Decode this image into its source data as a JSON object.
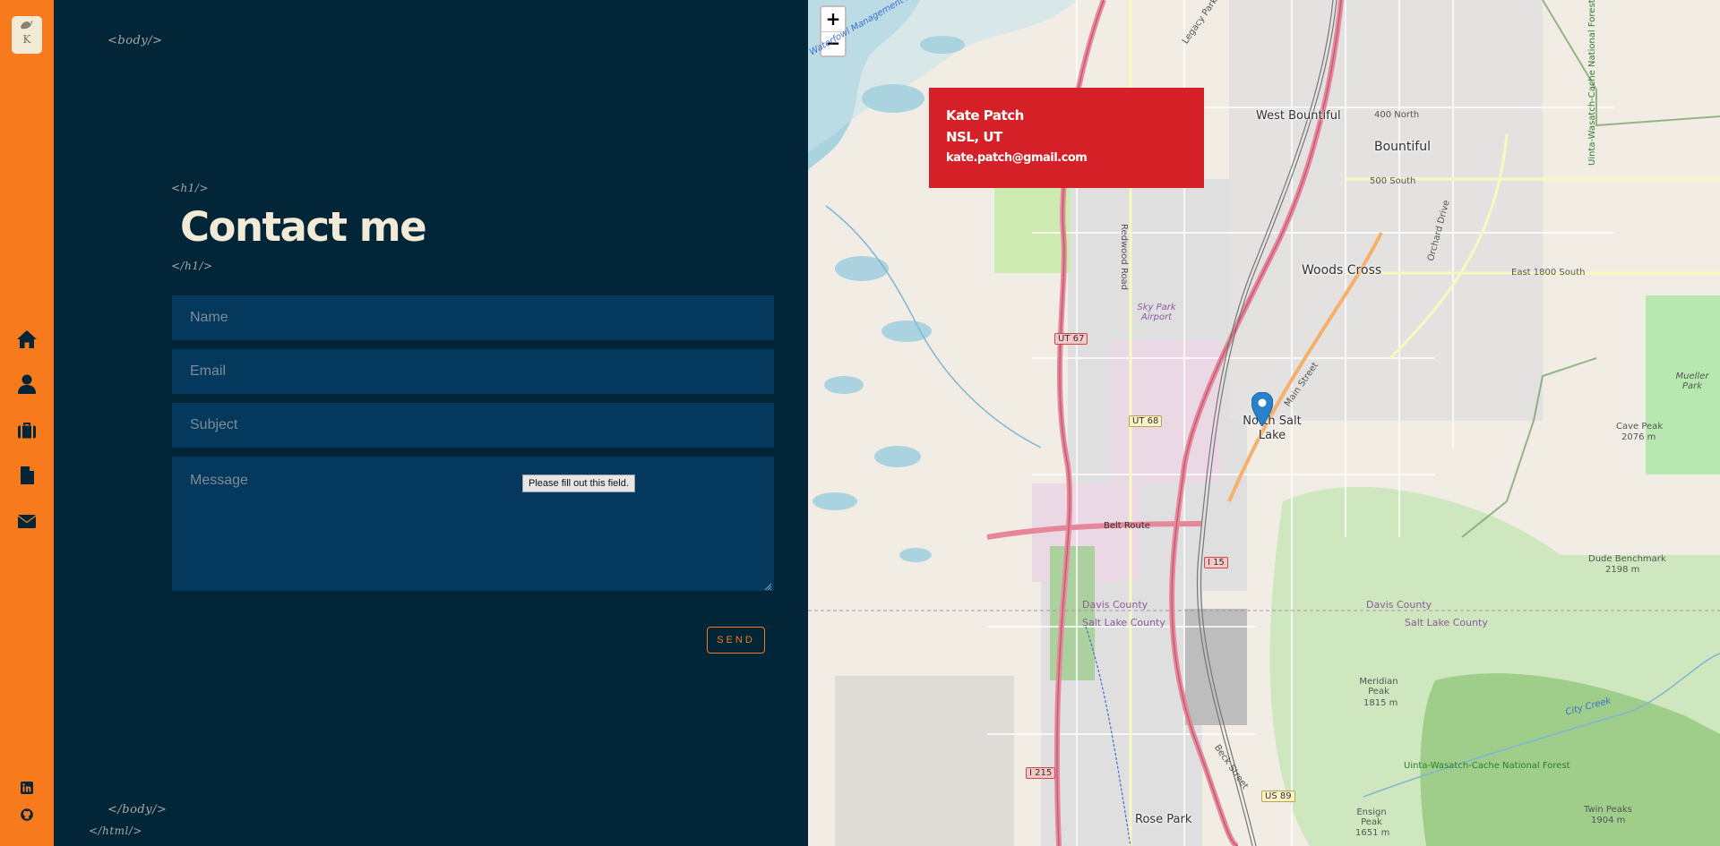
{
  "sidebar": {
    "logo_letter": "K",
    "nav_icons": [
      "home-icon",
      "user-icon",
      "briefcase-icon",
      "document-icon",
      "envelope-icon"
    ],
    "social_icons": [
      "linkedin-icon",
      "github-icon"
    ],
    "accent_color": "#f77a1c"
  },
  "tags": {
    "body_open": "<body/>",
    "h1_open": "<h1/>",
    "h1_close": "</h1/>",
    "body_close": "</body/>",
    "html_close": "</html/>"
  },
  "contact": {
    "title": "Contact me",
    "name_placeholder": "Name",
    "email_placeholder": "Email",
    "subject_placeholder": "Subject",
    "message_placeholder": "Message",
    "validation_tooltip": "Please fill out this field.",
    "send_label": "SEND"
  },
  "map": {
    "zoom_in": "+",
    "zoom_out": "−",
    "info": {
      "name": "Kate Patch",
      "location": "NSL, UT",
      "email": "kate.patch@gmail.com",
      "color": "#d42026"
    },
    "labels": {
      "west_bountiful": "West Bountiful",
      "bountiful": "Bountiful",
      "woods_cross": "Woods Cross",
      "north_salt_lake": "North Salt Lake",
      "rose_park": "Rose Park",
      "davis_county": "Davis County",
      "salt_lake_county": "Salt Lake County",
      "sky_park_airport": "Sky Park Airport",
      "cave_peak": "Cave Peak",
      "cave_peak_elev": "2076 m",
      "mueller_park": "Mueller Park",
      "dude_benchmark": "Dude Benchmark",
      "dude_benchmark_elev": "2198 m",
      "meridian_peak": "Meridian Peak",
      "meridian_peak_elev": "1815 m",
      "ensign_peak": "Ensign Peak",
      "ensign_peak_elev": "1651 m",
      "twin_peaks": "Twin Peaks",
      "twin_peaks_elev": "1904 m",
      "forest": "Uinta-Wasatch-Cache National Forest",
      "ut67": "UT 67",
      "ut68": "UT 68",
      "i15": "I 15",
      "i215": "I 215",
      "us89": "US 89",
      "belt_route": "Belt Route",
      "legacy_parkway": "Legacy Parkway",
      "redwood_road": "Redwood Road",
      "south_500": "500 South",
      "east_1800": "East 1800 South",
      "west_400": "400 North",
      "main_street": "Main Street",
      "beck_street": "Beck Street",
      "orchard_drive": "Orchard Drive",
      "city_creek": "City Creek",
      "waterfowl": "Waterfowl Management Area"
    }
  }
}
